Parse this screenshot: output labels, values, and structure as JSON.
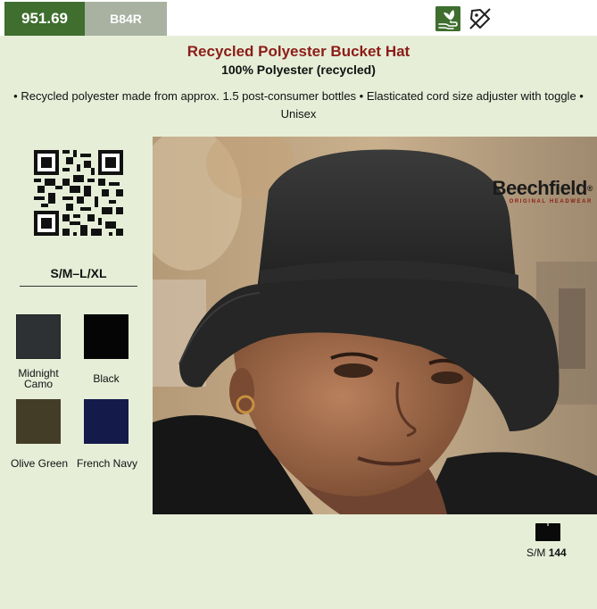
{
  "header": {
    "code": "951.69",
    "style_code": "B84R",
    "icons": [
      "eco-hand-leaf-icon",
      "no-tag-icon"
    ]
  },
  "product": {
    "title": "Recycled Polyester Bucket Hat",
    "material": "100% Polyester (recycled)",
    "features": "• Recycled polyester made from approx. 1.5 post-consumer bottles • Elasticated cord size adjuster with toggle • Unisex"
  },
  "sizes": {
    "range": "S/M–L/XL"
  },
  "colors": [
    {
      "name_line1": "Midnight",
      "name_line2": "Camo",
      "hex": "#2e3133"
    },
    {
      "name_line1": "Black",
      "name_line2": "",
      "hex": "#050505"
    },
    {
      "name_line1": "Olive Green",
      "name_line2": "",
      "hex": "#433d27"
    },
    {
      "name_line1": "French Navy",
      "name_line2": "",
      "hex": "#141a4a"
    }
  ],
  "brand": {
    "name": "Beechfield",
    "tagline": "ORIGINAL HEADWEAR",
    "registered": "®"
  },
  "packaging": {
    "size": "S/M",
    "quantity": "144"
  },
  "palette": {
    "accent_green": "#3f6e2f",
    "accent_grey": "#a9b1a1",
    "title_red": "#8c1c17",
    "panel_bg": "#e6eed8"
  }
}
